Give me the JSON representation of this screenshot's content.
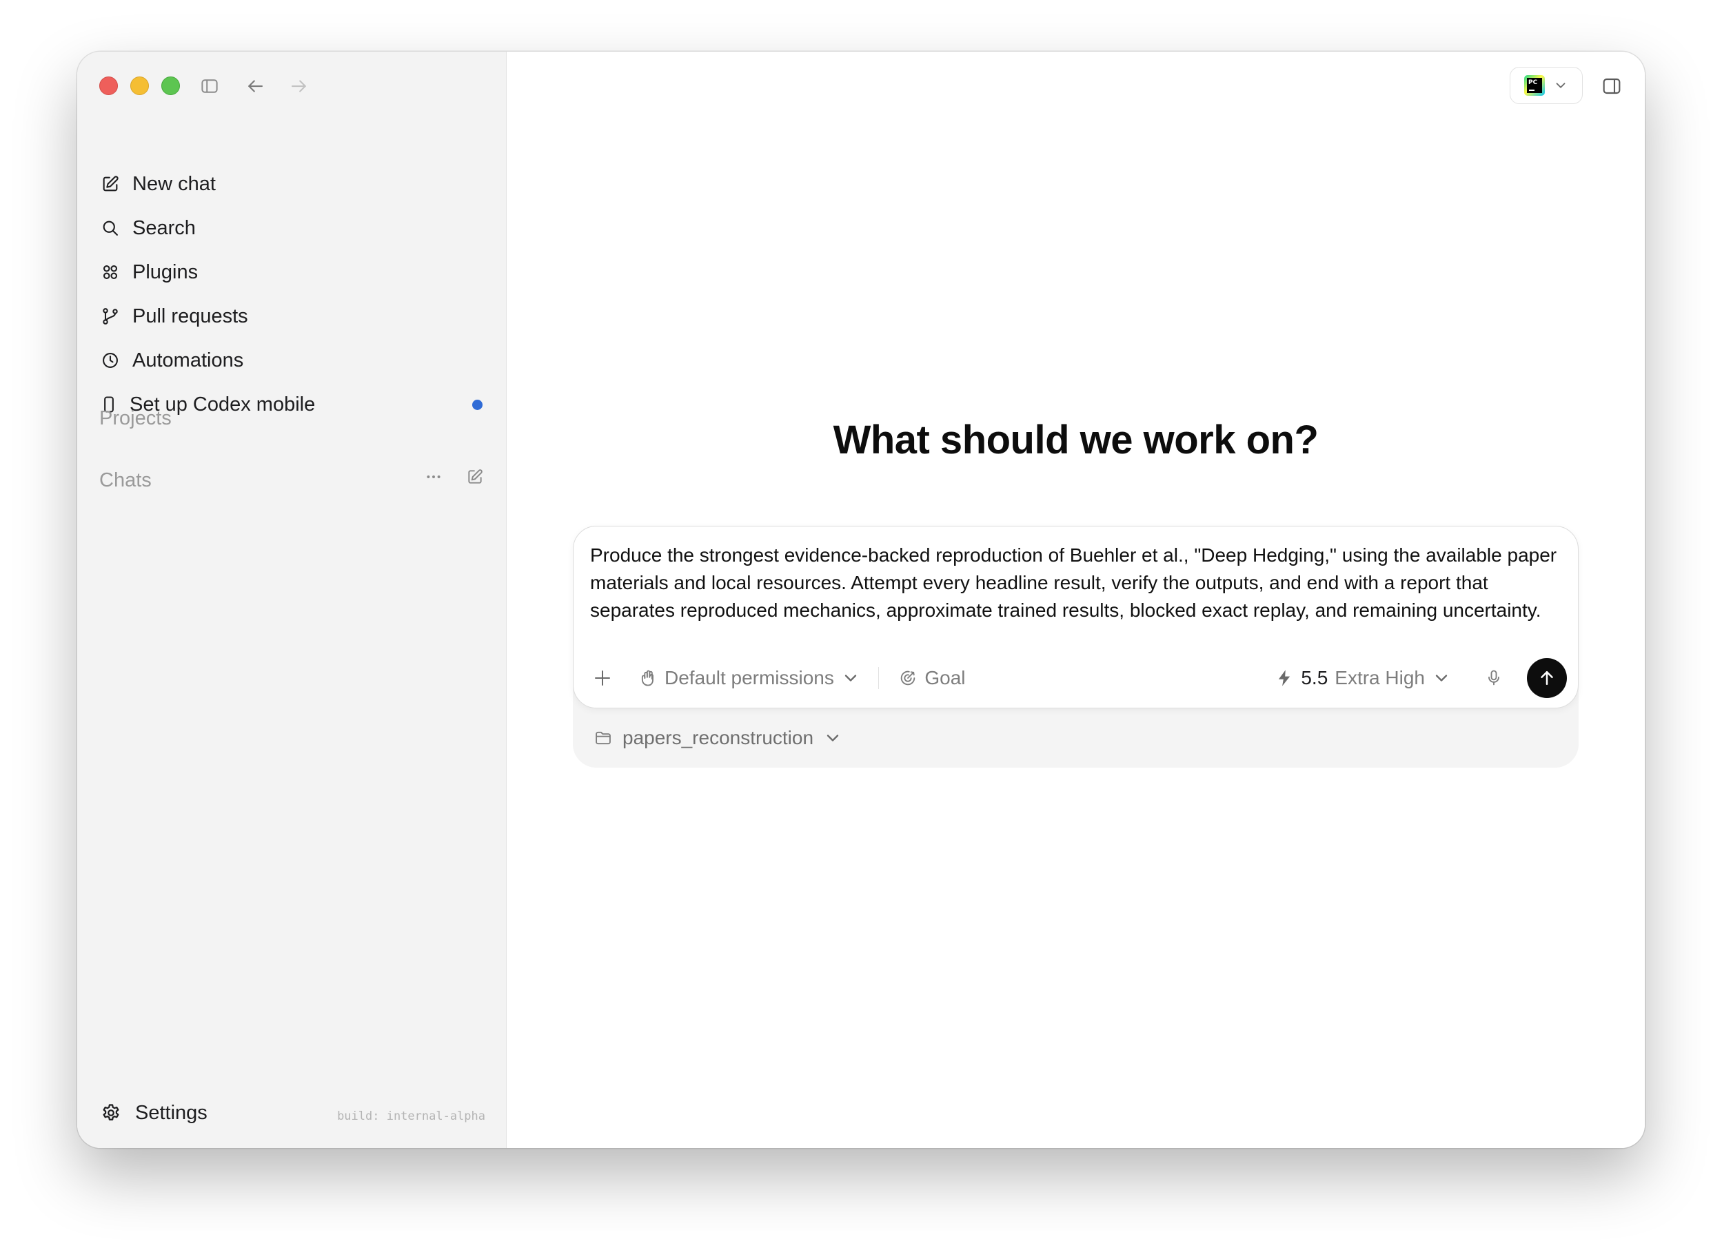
{
  "sidebar": {
    "items": [
      {
        "label": "New chat",
        "icon": "compose-icon"
      },
      {
        "label": "Search",
        "icon": "search-icon"
      },
      {
        "label": "Plugins",
        "icon": "plugins-icon"
      },
      {
        "label": "Pull requests",
        "icon": "git-branch-icon"
      },
      {
        "label": "Automations",
        "icon": "clock-icon"
      },
      {
        "label": "Set up Codex mobile",
        "icon": "phone-icon",
        "badge": "unread-dot"
      }
    ],
    "projects_label": "Projects",
    "chats_label": "Chats",
    "settings_label": "Settings",
    "build_label": "build: internal-alpha"
  },
  "main": {
    "heading": "What should we work on?",
    "composer": {
      "prompt": "Produce the strongest evidence-backed reproduction of Buehler et al., \"Deep Hedging,\" using the available paper materials and local resources. Attempt every headline result, verify the outputs, and end with a report that separates reproduced mechanics, approximate trained results, blocked exact replay, and remaining uncertainty.",
      "permissions_label": "Default permissions",
      "goal_label": "Goal",
      "model_version": "5.5",
      "reasoning_label": "Extra High",
      "folder_label": "papers_reconstruction"
    },
    "ide_icon": "pycharm-icon"
  },
  "colors": {
    "sidebar_bg": "#f3f3f3",
    "accent_dot": "#2f6bd6",
    "send_button": "#0d0d0d"
  }
}
